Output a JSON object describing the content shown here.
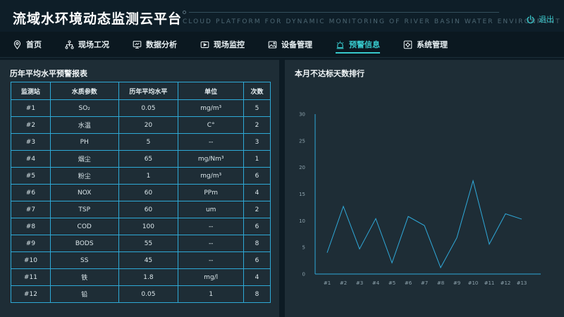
{
  "header": {
    "title": "流域水环境动态监测云平台",
    "subtitle": "CLOUD PLATFORM FOR DYNAMIC MONITORING OF RIVER BASIN WATER ENVIRONMENT",
    "logout_label": "退出"
  },
  "nav": {
    "items": [
      {
        "label": "首页",
        "icon": "location-pin-icon"
      },
      {
        "label": "现场工况",
        "icon": "sitemap-icon"
      },
      {
        "label": "数据分析",
        "icon": "monitor-chart-icon"
      },
      {
        "label": "现场监控",
        "icon": "video-icon"
      },
      {
        "label": "设备管理",
        "icon": "image-icon"
      },
      {
        "label": "预警信息",
        "icon": "alarm-icon",
        "active": true
      },
      {
        "label": "系统管理",
        "icon": "settings-box-icon"
      }
    ]
  },
  "left_panel": {
    "title": "历年平均水平预警报表",
    "columns": [
      "监测站",
      "水质参数",
      "历年平均水平",
      "单位",
      "次数"
    ],
    "rows": [
      [
        "#1",
        "SO₂",
        "0.05",
        "mg/m³",
        "5"
      ],
      [
        "#2",
        "水温",
        "20",
        "C°",
        "2"
      ],
      [
        "#3",
        "PH",
        "5",
        "--",
        "3"
      ],
      [
        "#4",
        "烟尘",
        "65",
        "mg/Nm³",
        "1"
      ],
      [
        "#5",
        "粉尘",
        "1",
        "mg/m³",
        "6"
      ],
      [
        "#6",
        "NOX",
        "60",
        "PPm",
        "4"
      ],
      [
        "#7",
        "TSP",
        "60",
        "um",
        "2"
      ],
      [
        "#8",
        "COD",
        "100",
        "--",
        "6"
      ],
      [
        "#9",
        "BODS",
        "55",
        "--",
        "8"
      ],
      [
        "#10",
        "SS",
        "45",
        "--",
        "6"
      ],
      [
        "#11",
        "铁",
        "1.8",
        "mg/l",
        "4"
      ],
      [
        "#12",
        "铅",
        "0.05",
        "1",
        "8"
      ]
    ]
  },
  "right_panel": {
    "title": "本月不达标天数排行"
  },
  "colors": {
    "accent": "#37c8cb",
    "line": "#2fa8d8",
    "table_border": "#2ea9d6"
  },
  "chart_data": {
    "type": "line",
    "title": "本月不达标天数排行",
    "categories": [
      "#1",
      "#2",
      "#3",
      "#4",
      "#5",
      "#6",
      "#7",
      "#8",
      "#9",
      "#10",
      "#11",
      "#12",
      "#13"
    ],
    "values": [
      4,
      12.7,
      4.7,
      10.4,
      2.1,
      10.8,
      9.1,
      1.2,
      6.8,
      17.5,
      5.6,
      11.3,
      10.3
    ],
    "ylim": [
      0,
      30
    ],
    "yticks": [
      0,
      5,
      10,
      15,
      20,
      25,
      30
    ],
    "grid": false,
    "legend": "none"
  }
}
